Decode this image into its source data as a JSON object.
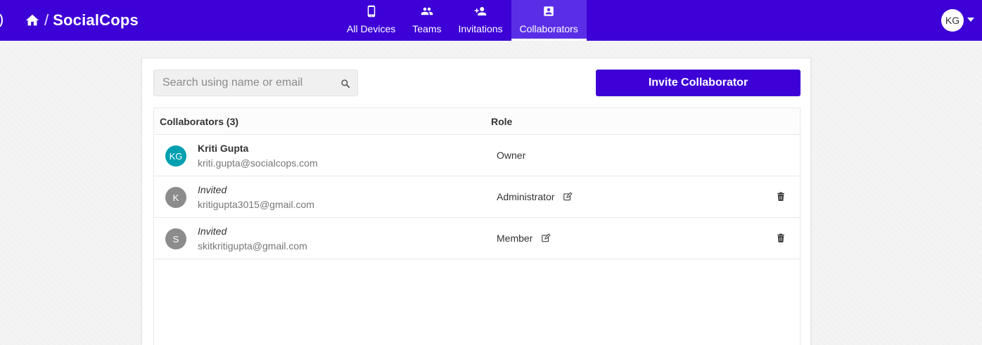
{
  "header": {
    "brand": "SocialCops",
    "slash": "/",
    "home_icon": "home-icon",
    "nav": [
      {
        "label": "All Devices",
        "icon": "phone-icon"
      },
      {
        "label": "Teams",
        "icon": "group-icon"
      },
      {
        "label": "Invitations",
        "icon": "person-add-icon"
      },
      {
        "label": "Collaborators",
        "icon": "contact-card-icon",
        "active": true
      }
    ],
    "user_initials": "KG"
  },
  "toolbar": {
    "search_placeholder": "Search using name or email",
    "search_value": "",
    "invite_label": "Invite Collaborator"
  },
  "table": {
    "col_collaborators": "Collaborators (3)",
    "col_role": "Role",
    "rows": [
      {
        "initials": "KG",
        "avatar_color": "#00a0b0",
        "name": "Kriti Gupta",
        "email": "kriti.gupta@socialcops.com",
        "role": "Owner"
      },
      {
        "initials": "K",
        "avatar_color": "#8c8c8c",
        "name": "Invited",
        "email": "kritigupta3015@gmail.com",
        "role": "Administrator"
      },
      {
        "initials": "S",
        "avatar_color": "#8c8c8c",
        "name": "Invited",
        "email": "skitkritigupta@gmail.com",
        "role": "Member"
      }
    ]
  },
  "colors": {
    "brand": "#3d00d6",
    "active_tab": "#5a2ee6"
  }
}
